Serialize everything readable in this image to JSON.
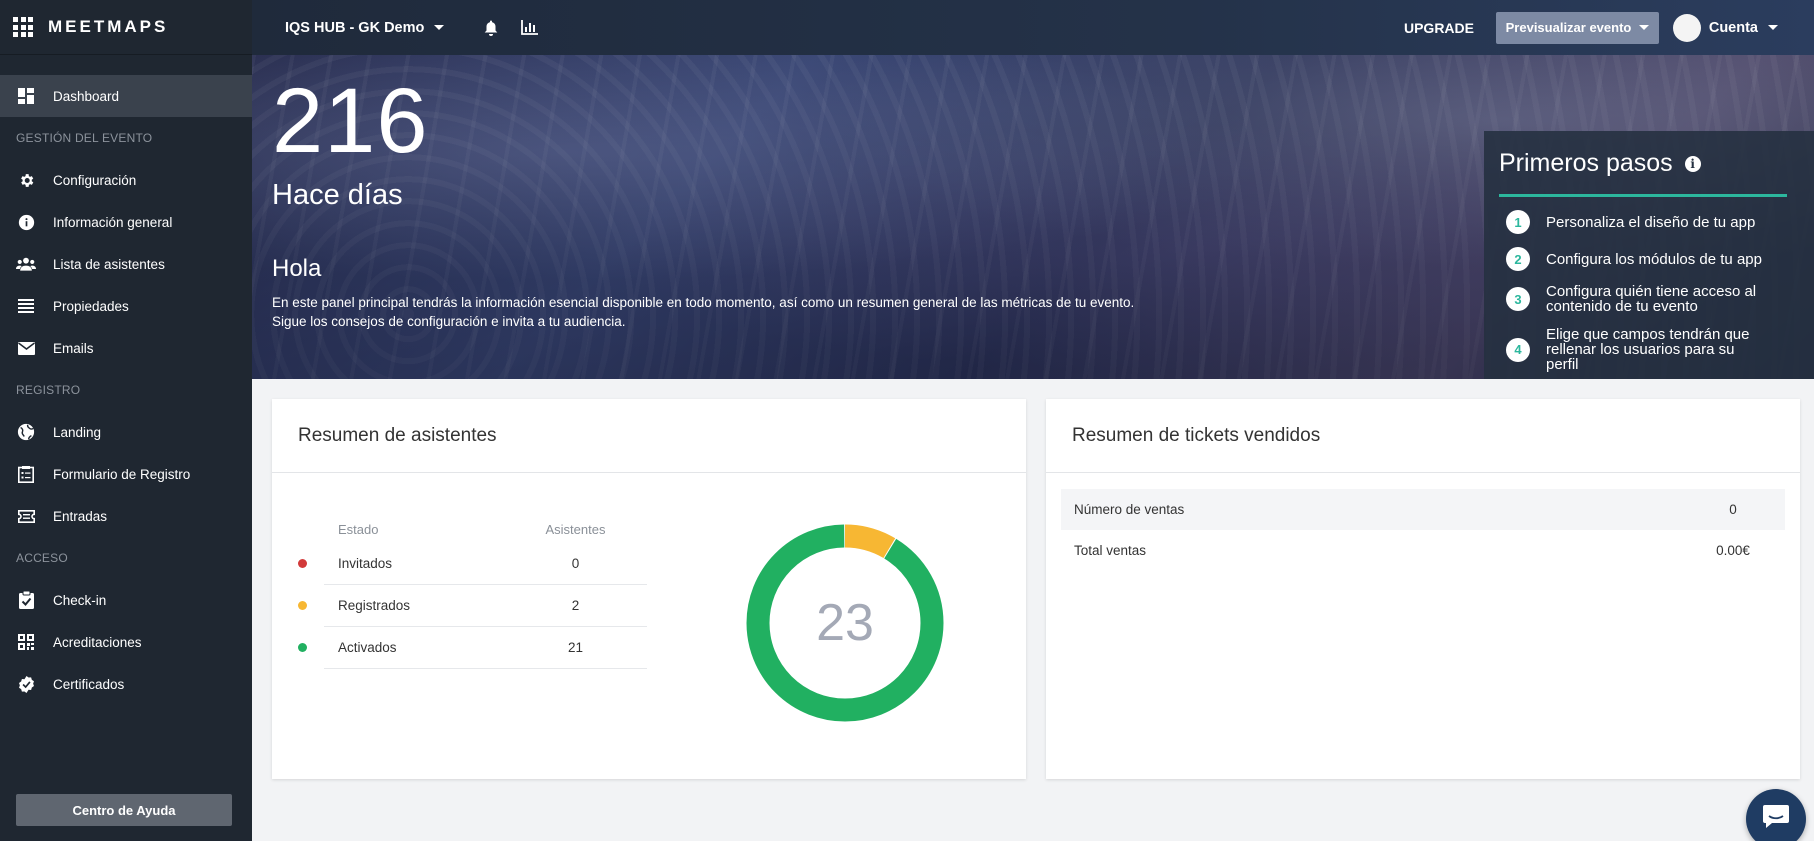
{
  "brand": {
    "name": "MEETMAPS"
  },
  "topbar": {
    "event_name": "IQS HUB - GK Demo",
    "upgrade_label": "UPGRADE",
    "preview_label": "Previsualizar evento",
    "account_label": "Cuenta"
  },
  "sidebar": {
    "dashboard": "Dashboard",
    "sections": {
      "gestion": "GESTIÓN DEL EVENTO",
      "registro": "REGISTRO",
      "acceso": "ACCESO"
    },
    "items": {
      "configuracion": "Configuración",
      "informacion": "Información general",
      "asistentes": "Lista de asistentes",
      "propiedades": "Propiedades",
      "emails": "Emails",
      "landing": "Landing",
      "formulario": "Formulario de Registro",
      "entradas": "Entradas",
      "checkin": "Check-in",
      "acreditaciones": "Acreditaciones",
      "certificados": "Certificados"
    },
    "help_label": "Centro de Ayuda"
  },
  "hero": {
    "days_number": "216",
    "days_label": "Hace días",
    "hello": "Hola",
    "description_line1": "En este panel principal tendrás la información esencial disponible en todo momento, así como un resumen general de las métricas de tu evento.",
    "description_line2": "Sigue los consejos de configuración e invita a tu audiencia."
  },
  "steps": {
    "title": "Primeros pasos",
    "info": "i",
    "items": [
      {
        "num": "1",
        "text": "Personaliza el diseño de tu app"
      },
      {
        "num": "2",
        "text": "Configura los módulos de tu app"
      },
      {
        "num": "3",
        "text": "Configura quién tiene acceso al contenido de tu evento"
      },
      {
        "num": "4",
        "text": "Elige que campos tendrán que rellenar los usuarios para su perfil"
      }
    ]
  },
  "attendees": {
    "title": "Resumen de asistentes",
    "header_state": "Estado",
    "header_count": "Asistentes",
    "rows": [
      {
        "state": "Invitados",
        "count": "0",
        "value": 0,
        "color": "#d23a3a"
      },
      {
        "state": "Registrados",
        "count": "2",
        "value": 2,
        "color": "#f7b733"
      },
      {
        "state": "Activados",
        "count": "21",
        "value": 21,
        "color": "#21b061"
      }
    ],
    "total": "23"
  },
  "tickets": {
    "title": "Resumen de tickets vendidos",
    "rows": [
      {
        "label": "Número de ventas",
        "value": "0"
      },
      {
        "label": "Total ventas",
        "value": "0.00€"
      }
    ]
  },
  "colors": {
    "accent": "#2cb79d",
    "sidebar": "#1f2731",
    "topbar": "#243249"
  }
}
